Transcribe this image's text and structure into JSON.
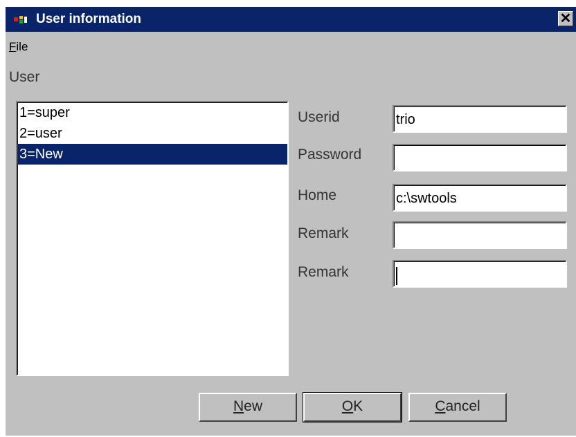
{
  "window": {
    "title": "User information",
    "close_glyph": "✕"
  },
  "menu": {
    "file_access_key": "F",
    "file_rest": "ile"
  },
  "user_label": "User",
  "users": [
    {
      "label": "1=super",
      "selected": false
    },
    {
      "label": "2=user",
      "selected": false
    },
    {
      "label": "3=New",
      "selected": true
    }
  ],
  "fields": {
    "userid": {
      "label": "Userid",
      "value": "trio"
    },
    "password": {
      "label": "Password",
      "value": ""
    },
    "home": {
      "label": "Home",
      "value": "c:\\swtools"
    },
    "remark1": {
      "label": "Remark",
      "value": ""
    },
    "remark2": {
      "label": "Remark",
      "value": ""
    }
  },
  "buttons": {
    "new": {
      "key": "N",
      "rest": "ew"
    },
    "ok": {
      "key": "O",
      "rest": "K"
    },
    "cancel": {
      "key": "C",
      "rest": "ancel"
    }
  },
  "colors": {
    "titlebar": "#0a246a",
    "face": "#c0c0c0",
    "selection": "#0a246a"
  },
  "icons": {
    "app": "app-icon",
    "close": "close-icon"
  }
}
